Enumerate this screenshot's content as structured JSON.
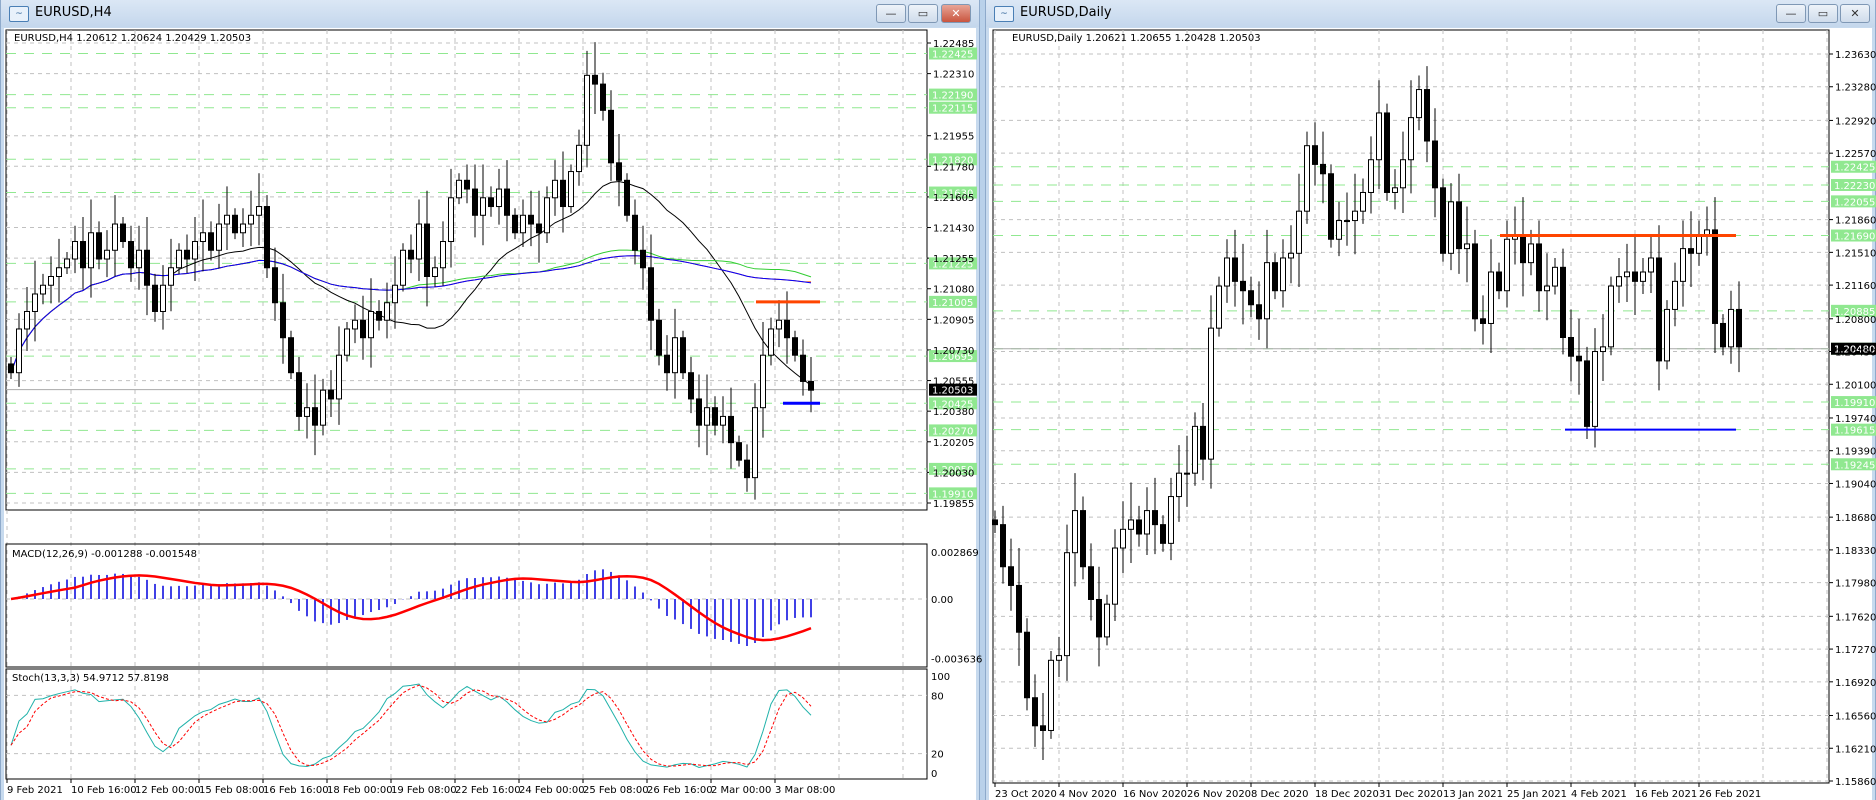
{
  "left_window": {
    "title": "EURUSD,H4",
    "legend": "EURUSD,H4  1.20612 1.20624 1.20429 1.20503",
    "macd_label": "MACD(12,26,9) -0.001288 -0.001548",
    "stoch_label": "Stoch(13,3,3) 54.9712 57.8198",
    "price_ticks": [
      "1.22485",
      "1.22310",
      "1.21955",
      "1.21780",
      "1.21605",
      "1.21430",
      "1.21255",
      "1.21080",
      "1.20905",
      "1.20730",
      "1.20555",
      "1.20380",
      "1.20205",
      "1.20030",
      "1.19855"
    ],
    "level_lines": [
      "1.22425",
      "1.22190",
      "1.22115",
      "1.21820",
      "1.21630",
      "1.21225",
      "1.21005",
      "1.20695",
      "1.20425",
      "1.20270",
      "1.20050",
      "1.19910"
    ],
    "current_price": "1.20503",
    "macd_ticks": [
      "0.002869",
      "0.00",
      "-0.003636"
    ],
    "stoch_ticks": [
      "100",
      "80",
      "20",
      "0"
    ],
    "time_labels": [
      "9 Feb 2021",
      "10 Feb 16:00",
      "12 Feb 00:00",
      "15 Feb 08:00",
      "16 Feb 16:00",
      "18 Feb 00:00",
      "19 Feb 08:00",
      "22 Feb 16:00",
      "24 Feb 00:00",
      "25 Feb 08:00",
      "26 Feb 16:00",
      "2 Mar 00:00",
      "3 Mar 08:00"
    ],
    "resistance": 1.21005,
    "support": 1.20425
  },
  "right_window": {
    "title": "EURUSD,Daily",
    "legend": "EURUSD,Daily  1.20621 1.20655 1.20428 1.20503",
    "price_ticks": [
      "1.23630",
      "1.23280",
      "1.22920",
      "1.22570",
      "1.21860",
      "1.21510",
      "1.21160",
      "1.20800",
      "1.20450",
      "1.20100",
      "1.19740",
      "1.19390",
      "1.19040",
      "1.18680",
      "1.18330",
      "1.17980",
      "1.17620",
      "1.17270",
      "1.16920",
      "1.16560",
      "1.16210",
      "1.15860"
    ],
    "level_lines": [
      "1.22425",
      "1.22230",
      "1.22055",
      "1.21690",
      "1.20885",
      "1.20480",
      "1.19910",
      "1.19615",
      "1.19245"
    ],
    "current_price": "1.20480",
    "time_labels": [
      "23 Oct 2020",
      "4 Nov 2020",
      "16 Nov 2020",
      "26 Nov 2020",
      "8 Dec 2020",
      "18 Dec 2020",
      "31 Dec 2020",
      "13 Jan 2021",
      "25 Jan 2021",
      "4 Feb 2021",
      "16 Feb 2021",
      "26 Feb 2021"
    ],
    "resistance": 1.2169,
    "support": 1.19615
  },
  "window_buttons": {
    "minimize": "—",
    "restore": "▭",
    "close": "✕"
  },
  "colors": {
    "level": "#90e890",
    "resistance": "#ff4500",
    "support": "#0000ff",
    "macd_hist": "#0000dd",
    "macd_signal": "#ff0000",
    "stoch_main": "#20b2aa",
    "stoch_signal": "#ff0000",
    "ma_black": "#000000",
    "ma_green": "#32cd32",
    "ma_orange": "#ff4500",
    "ma_blue": "#0000ff"
  },
  "chart_data": [
    {
      "type": "candlestick",
      "title": "EURUSD,H4",
      "ylim": [
        1.19855,
        1.22485
      ],
      "closes": [
        1.206,
        1.2085,
        1.2095,
        1.2105,
        1.211,
        1.2115,
        1.212,
        1.2125,
        1.2135,
        1.212,
        1.214,
        1.2125,
        1.213,
        1.2145,
        1.2135,
        1.212,
        1.213,
        1.211,
        1.2095,
        1.211,
        1.212,
        1.213,
        1.2125,
        1.2135,
        1.214,
        1.213,
        1.2145,
        1.215,
        1.214,
        1.2145,
        1.215,
        1.2155,
        1.212,
        1.21,
        1.208,
        1.206,
        1.2035,
        1.204,
        1.203,
        1.205,
        1.2045,
        1.207,
        1.2085,
        1.209,
        1.208,
        1.2095,
        1.209,
        1.21,
        1.211,
        1.213,
        1.2125,
        1.2145,
        1.2115,
        1.212,
        1.2135,
        1.216,
        1.217,
        1.2165,
        1.215,
        1.216,
        1.2155,
        1.2165,
        1.215,
        1.214,
        1.215,
        1.2145,
        1.214,
        1.216,
        1.217,
        1.2155,
        1.2175,
        1.219,
        1.223,
        1.2225,
        1.221,
        1.218,
        1.217,
        1.215,
        1.213,
        1.212,
        1.209,
        1.207,
        1.206,
        1.208,
        1.206,
        1.2045,
        1.203,
        1.204,
        1.203,
        1.2035,
        1.202,
        1.201,
        1.2,
        1.204,
        1.207,
        1.2085,
        1.209,
        1.208,
        1.207,
        1.2055,
        1.205
      ]
    },
    {
      "type": "candlestick",
      "title": "EURUSD,Daily",
      "ylim": [
        1.1586,
        1.2363
      ],
      "closes": [
        1.186,
        1.1815,
        1.1795,
        1.1745,
        1.1675,
        1.1645,
        1.164,
        1.1715,
        1.172,
        1.183,
        1.1875,
        1.1815,
        1.178,
        1.174,
        1.1775,
        1.1835,
        1.1855,
        1.1865,
        1.185,
        1.1875,
        1.186,
        1.184,
        1.189,
        1.1915,
        1.1915,
        1.1965,
        1.193,
        1.207,
        1.2115,
        1.2145,
        1.212,
        1.211,
        1.2095,
        1.208,
        1.214,
        1.211,
        1.2145,
        1.215,
        1.2195,
        1.2265,
        1.2245,
        1.2235,
        1.2165,
        1.2185,
        1.2185,
        1.2195,
        1.2215,
        1.225,
        1.23,
        1.2215,
        1.222,
        1.225,
        1.2295,
        1.2325,
        1.227,
        1.222,
        1.215,
        1.2205,
        1.2155,
        1.216,
        1.208,
        1.2075,
        1.213,
        1.211,
        1.2165,
        1.217,
        1.214,
        1.216,
        1.211,
        1.2115,
        1.2135,
        1.206,
        1.204,
        1.2035,
        1.1965,
        1.2045,
        1.205,
        1.2115,
        1.2125,
        1.213,
        1.212,
        1.213,
        1.2145,
        1.2035,
        1.209,
        1.212,
        1.2155,
        1.215,
        1.217,
        1.2175,
        1.2075,
        1.205,
        1.209,
        1.205
      ]
    }
  ]
}
